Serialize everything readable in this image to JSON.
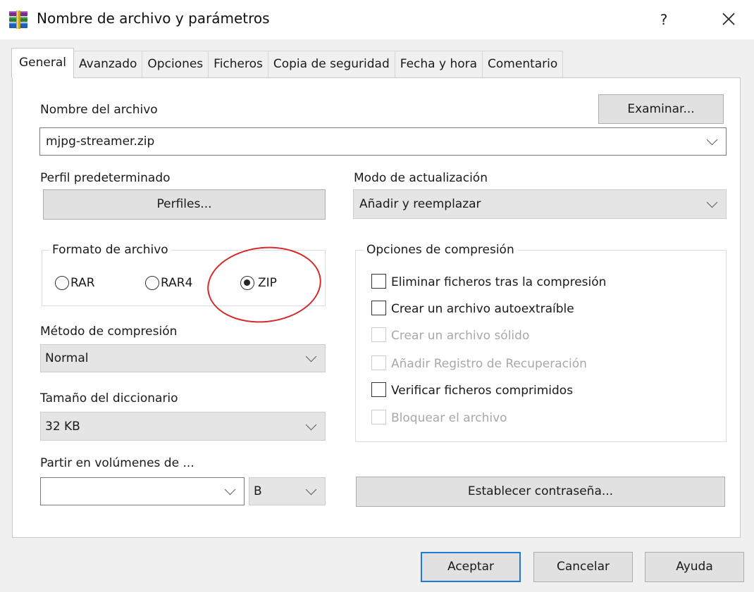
{
  "window": {
    "title": "Nombre de archivo y parámetros",
    "help_label": "?",
    "close_label": "✕"
  },
  "tabs": [
    {
      "label": "General",
      "active": true
    },
    {
      "label": "Avanzado"
    },
    {
      "label": "Opciones"
    },
    {
      "label": "Ficheros"
    },
    {
      "label": "Copia de seguridad"
    },
    {
      "label": "Fecha y hora"
    },
    {
      "label": "Comentario"
    }
  ],
  "general": {
    "archive_name_label": "Nombre del archivo",
    "browse_button": "Examinar...",
    "archive_name_value": "mjpg-streamer.zip",
    "default_profile_label": "Perfil predeterminado",
    "profiles_button": "Perfiles...",
    "update_mode_label": "Modo de actualización",
    "update_mode_value": "Añadir y reemplazar",
    "archive_format": {
      "title": "Formato de archivo",
      "options": [
        "RAR",
        "RAR4",
        "ZIP"
      ],
      "selected": "ZIP"
    },
    "compression_method_label": "Método de compresión",
    "compression_method_value": "Normal",
    "dictionary_size_label": "Tamaño del diccionario",
    "dictionary_size_value": "32 KB",
    "split_volumes_label": "Partir en volúmenes de ...",
    "split_volumes_value": "",
    "split_unit_value": "B",
    "compression_options": {
      "title": "Opciones de compresión",
      "items": [
        {
          "label": "Eliminar ficheros tras la compresión",
          "checked": false,
          "enabled": true
        },
        {
          "label": "Crear un archivo autoextraíble",
          "checked": false,
          "enabled": true
        },
        {
          "label": "Crear un archivo sólido",
          "checked": false,
          "enabled": false
        },
        {
          "label": "Añadir Registro de Recuperación",
          "checked": false,
          "enabled": false
        },
        {
          "label": "Verificar ficheros comprimidos",
          "checked": false,
          "enabled": true
        },
        {
          "label": "Bloquear el archivo",
          "checked": false,
          "enabled": false
        }
      ]
    },
    "set_password_button": "Establecer contraseña..."
  },
  "footer": {
    "ok_button": "Aceptar",
    "cancel_button": "Cancelar",
    "help_button": "Ayuda"
  },
  "colors": {
    "annotation_ellipse": "#d42a2a",
    "default_button_border": "#1d7bd7",
    "panel_background": "#ffffff",
    "window_background": "#f0f0f0"
  }
}
